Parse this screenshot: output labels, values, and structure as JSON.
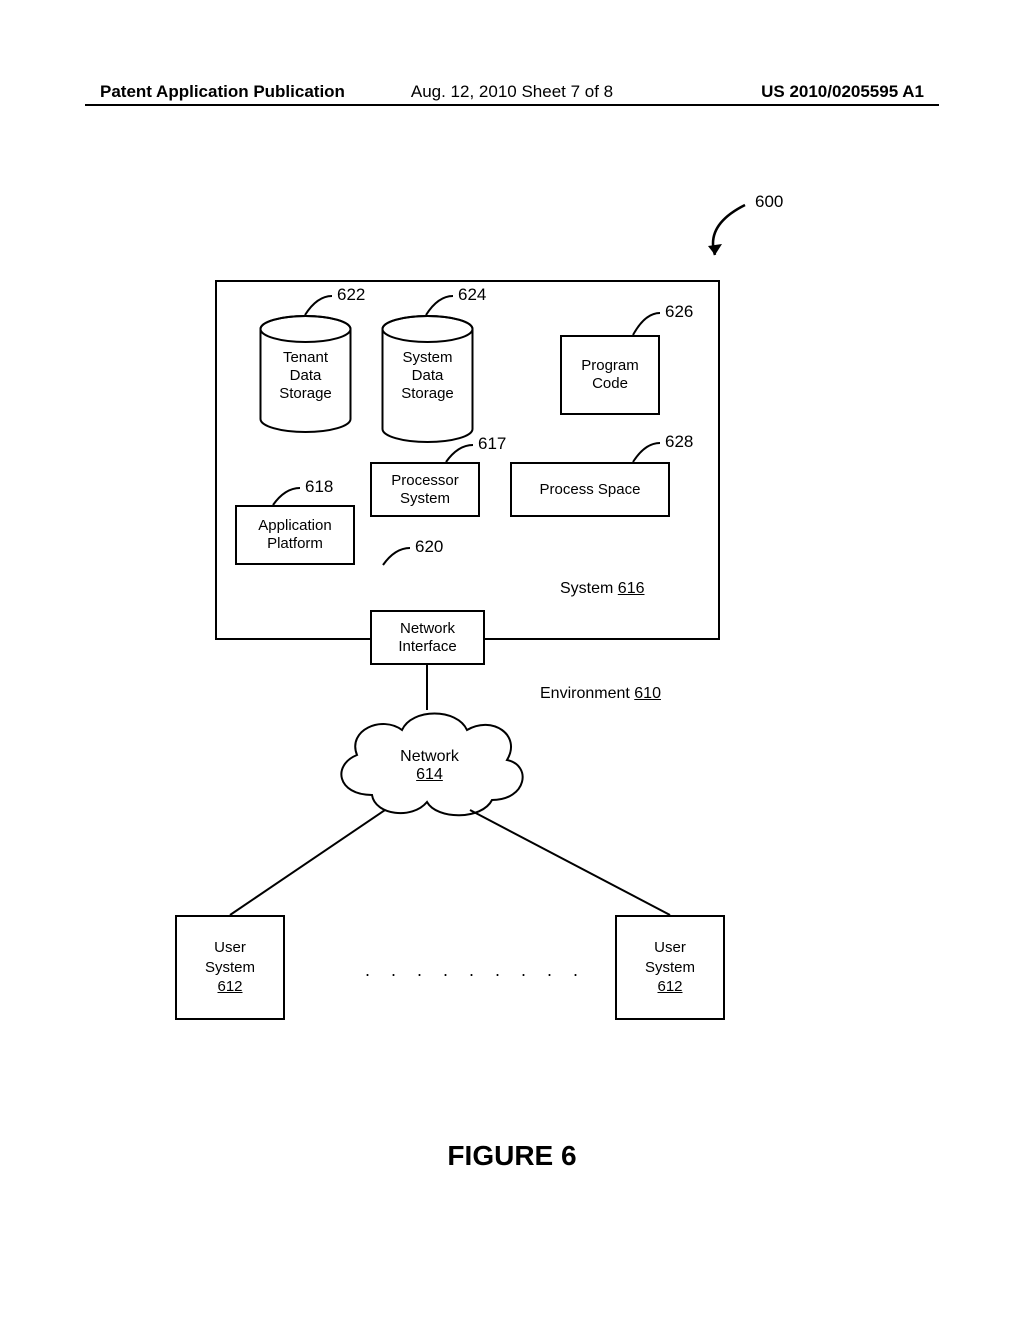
{
  "header": {
    "left": "Patent Application Publication",
    "center": "Aug. 12, 2010  Sheet 7 of 8",
    "right": "US 2010/0205595 A1"
  },
  "refs": {
    "r600": "600",
    "r622": "622",
    "r624": "624",
    "r626": "626",
    "r617": "617",
    "r628": "628",
    "r618": "618",
    "r620": "620"
  },
  "boxes": {
    "tenant_data": "Tenant\nData\nStorage",
    "system_data": "System\nData\nStorage",
    "program_code": "Program\nCode",
    "processor_system": "Processor\nSystem",
    "process_space": "Process Space",
    "application_platform": "Application\nPlatform",
    "network_interface": "Network\nInterface",
    "system_label_prefix": "System ",
    "system_label_num": "616",
    "environment_prefix": "Environment ",
    "environment_num": "610",
    "network_label": "Network",
    "network_num": "614",
    "user_system": "User\nSystem",
    "user_system_num": "612",
    "ellipsis": ". . . . . . . . ."
  },
  "figure_title": "FIGURE 6"
}
